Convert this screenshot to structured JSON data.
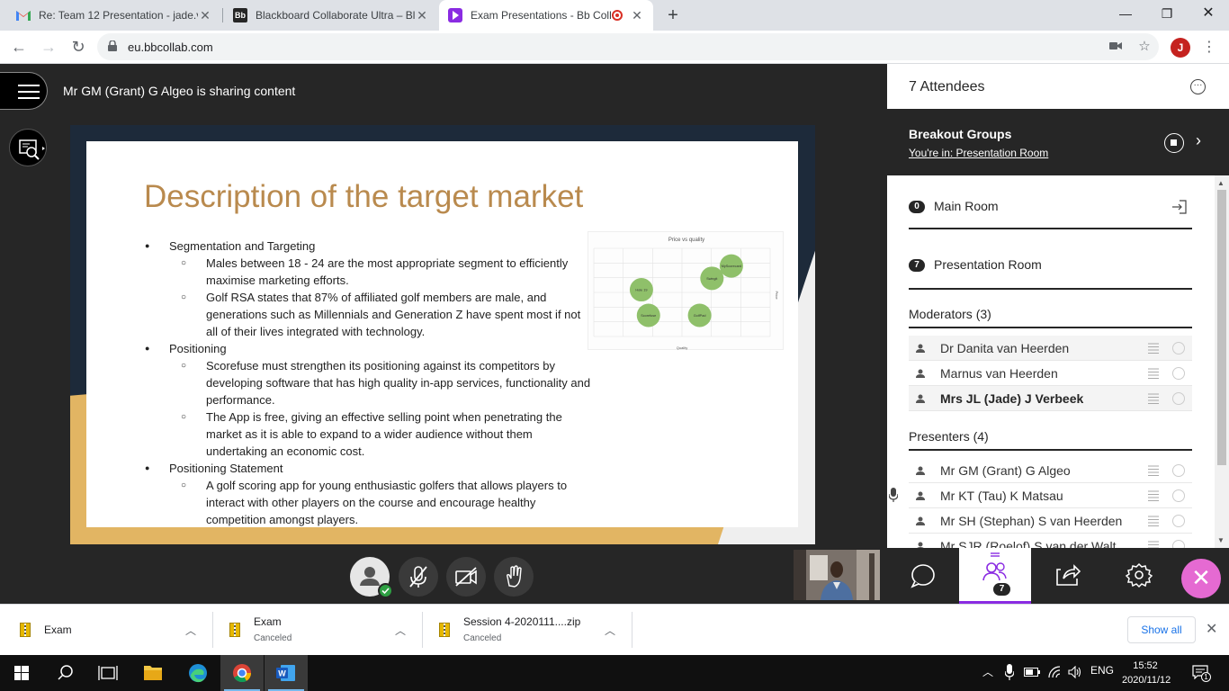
{
  "browser": {
    "tabs": [
      {
        "title": "Re: Team 12 Presentation - jade.v",
        "favicon": "gmail-icon"
      },
      {
        "title": "Blackboard Collaborate Ultra – Bl",
        "favicon": "bb-icon"
      },
      {
        "title": "Exam Presentations - Bb Coll",
        "favicon": "collab-icon",
        "active": true
      }
    ],
    "favicon_bb_text": "Bb",
    "url": "eu.bbcollab.com",
    "profile_initial": "J"
  },
  "session": {
    "sharing_text": "Mr GM (Grant) G Algeo is sharing content"
  },
  "slide": {
    "title": "Description of the target market",
    "bullets": [
      {
        "level": 1,
        "text": "Segmentation and Targeting"
      },
      {
        "level": 2,
        "text": "Males between 18 - 24 are the most appropriate segment to efficiently maximise marketing efforts."
      },
      {
        "level": 2,
        "text": "Golf RSA states that 87% of affiliated golf members are male, and generations such as Millennials and Generation Z have spent most if not all of their lives integrated with technology."
      },
      {
        "level": 1,
        "text": "Positioning"
      },
      {
        "level": 2,
        "text": "Scorefuse must strengthen its positioning against its competitors by developing software that has high quality in-app services, functionality and performance."
      },
      {
        "level": 2,
        "text": "The App is free, giving an effective selling point when penetrating the market as it is able to expand to a wider audience without them undertaking an economic cost."
      },
      {
        "level": 1,
        "text": "Positioning Statement"
      },
      {
        "level": 2,
        "text": "A golf scoring app for young enthusiastic golfers that allows players to interact with other players on the course and encourage healthy competition amongst players."
      }
    ],
    "chart_data": {
      "type": "scatter",
      "title": "Price vs quality",
      "xlabel": "Quality",
      "ylabel": "Price",
      "xlim": [
        0,
        10
      ],
      "ylim": [
        0,
        10
      ],
      "points": [
        {
          "label": "MyScorecard",
          "x": 7.8,
          "y": 8.0
        },
        {
          "label": "Swingit",
          "x": 6.7,
          "y": 6.6
        },
        {
          "label": "Hole 19",
          "x": 2.7,
          "y": 5.3
        },
        {
          "label": "Scorefuse",
          "x": 3.1,
          "y": 2.4
        },
        {
          "label": "GolfPad",
          "x": 6.0,
          "y": 2.4
        }
      ]
    }
  },
  "panel": {
    "attendees_title": "7 Attendees",
    "breakout_title": "Breakout Groups",
    "breakout_sub": "You're in: Presentation Room",
    "rooms": [
      {
        "count": "0",
        "name": "Main Room"
      },
      {
        "count": "7",
        "name": "Presentation Room"
      }
    ],
    "moderators_title": "Moderators (3)",
    "moderators": [
      {
        "name": "Dr Danita van Heerden"
      },
      {
        "name": "Marnus van Heerden"
      },
      {
        "name": "Mrs JL (Jade) J Verbeek",
        "self": true
      }
    ],
    "presenters_title": "Presenters (4)",
    "presenters": [
      {
        "name": "Mr GM (Grant) G Algeo"
      },
      {
        "name": "Mr KT (Tau) K Matsau",
        "mic": true
      },
      {
        "name": "Mr SH (Stephan) S van Heerden"
      },
      {
        "name": "Mr SJR (Roelof) S van der Walt"
      }
    ],
    "people_count": "7"
  },
  "downloads": {
    "items": [
      {
        "name": "Exam",
        "status": ""
      },
      {
        "name": "Exam",
        "status": "Canceled"
      },
      {
        "name": "Session 4-2020111....zip",
        "status": "Canceled"
      }
    ],
    "show_all": "Show all"
  },
  "taskbar": {
    "language": "ENG",
    "time": "15:52",
    "date": "2020/11/12",
    "notification_count": "1"
  },
  "colors": {
    "collab_dark": "#262626",
    "accent_purple": "#8a2be2",
    "close_pink": "#e56ad2",
    "slide_title": "#b98a4e",
    "chart_point": "#8fc06a"
  }
}
